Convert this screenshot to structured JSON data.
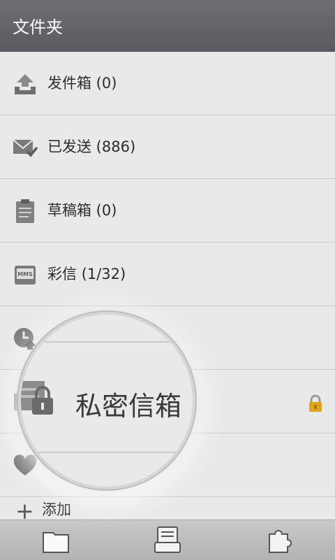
{
  "header": {
    "title": "文件夹"
  },
  "folders": [
    {
      "label": "发件箱 (0)",
      "icon": "outbox-icon"
    },
    {
      "label": "已发送 (886)",
      "icon": "sent-icon"
    },
    {
      "label": "草稿箱 (0)",
      "icon": "drafts-icon"
    },
    {
      "label": "彩信 (1/32)",
      "icon": "mms-icon"
    },
    {
      "label": "",
      "icon": "scheduled-icon"
    },
    {
      "label": "",
      "icon": "private-box-icon",
      "locked": true
    },
    {
      "label": "",
      "icon": "favorite-icon"
    }
  ],
  "magnifier": {
    "label": "私密信箱"
  },
  "add": {
    "label": "添加"
  },
  "bottom_tabs": [
    {
      "icon": "folder-tab-icon"
    },
    {
      "icon": "messages-tab-icon"
    },
    {
      "icon": "plugin-tab-icon"
    }
  ],
  "colors": {
    "header": "#5f6066",
    "background": "#e9e9e9",
    "lock": "#e0a41c"
  }
}
